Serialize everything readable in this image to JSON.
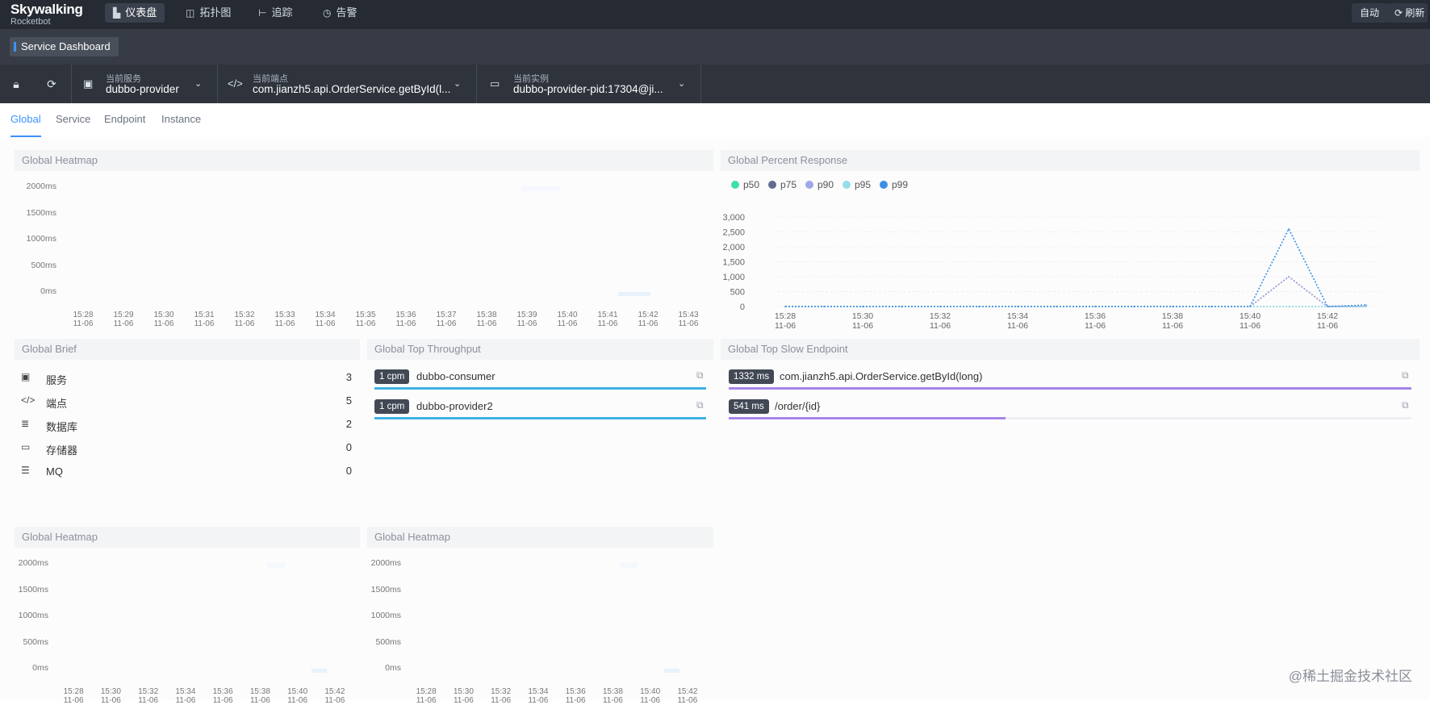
{
  "brand": {
    "name": "Skywalking",
    "sub": "Rocketbot"
  },
  "nav": [
    {
      "label": "仪表盘",
      "icon": "chart-icon"
    },
    {
      "label": "拓扑图",
      "icon": "topology-icon"
    },
    {
      "label": "追踪",
      "icon": "trace-icon"
    },
    {
      "label": "告警",
      "icon": "alarm-icon"
    }
  ],
  "top_right": {
    "auto": "自动",
    "refresh": "刷新"
  },
  "dashboard_tab": "Service Dashboard",
  "selectors": {
    "service": {
      "label": "当前服务",
      "value": "dubbo-provider"
    },
    "endpoint": {
      "label": "当前端点",
      "value": "com.jianzh5.api.OrderService.getById(l..."
    },
    "instance": {
      "label": "当前实例",
      "value": "dubbo-provider-pid:17304@ji..."
    }
  },
  "tabs": [
    "Global",
    "Service",
    "Endpoint",
    "Instance"
  ],
  "panels": {
    "heatmap_title": "Global Heatmap",
    "percent_title": "Global Percent Response",
    "brief_title": "Global Brief",
    "throughput_title": "Global Top Throughput",
    "slow_title": "Global Top Slow Endpoint"
  },
  "heatmap_y": [
    "2000ms",
    "1500ms",
    "1000ms",
    "500ms",
    "0ms"
  ],
  "heatmap_x_top": [
    "15:28",
    "15:29",
    "15:30",
    "15:31",
    "15:32",
    "15:33",
    "15:34",
    "15:35",
    "15:36",
    "15:37",
    "15:38",
    "15:39",
    "15:40",
    "15:41",
    "15:42",
    "15:43"
  ],
  "heatmap_x_bottom": [
    "15:28",
    "15:30",
    "15:32",
    "15:34",
    "15:36",
    "15:38",
    "15:40",
    "15:42"
  ],
  "date_label": "11-06",
  "brief": [
    {
      "label": "服务",
      "value": "3",
      "icon": "service-icon"
    },
    {
      "label": "端点",
      "value": "5",
      "icon": "code-icon"
    },
    {
      "label": "数据库",
      "value": "2",
      "icon": "database-icon"
    },
    {
      "label": "存储器",
      "value": "0",
      "icon": "storage-icon"
    },
    {
      "label": "MQ",
      "value": "0",
      "icon": "mq-icon"
    }
  ],
  "throughput": [
    {
      "badge": "1 cpm",
      "name": "dubbo-consumer",
      "fraction": 1.0
    },
    {
      "badge": "1 cpm",
      "name": "dubbo-provider2",
      "fraction": 1.0
    }
  ],
  "slow": [
    {
      "badge": "1332 ms",
      "name": "com.jianzh5.api.OrderService.getById(long)",
      "fraction": 1.0
    },
    {
      "badge": "541 ms",
      "name": "/order/{id}",
      "fraction": 0.406
    }
  ],
  "colors": {
    "throughput_bar": "#3fb1e3",
    "slow_bar": "#a685e9",
    "accent": "#3d92fe"
  },
  "chart_data": {
    "type": "line",
    "title": "Global Percent Response",
    "x": [
      "15:28",
      "15:29",
      "15:30",
      "15:31",
      "15:32",
      "15:33",
      "15:34",
      "15:35",
      "15:36",
      "15:37",
      "15:38",
      "15:39",
      "15:40",
      "15:41",
      "15:42",
      "15:43"
    ],
    "x_tick_labels": [
      "15:28",
      "15:30",
      "15:32",
      "15:34",
      "15:36",
      "15:38",
      "15:40",
      "15:42"
    ],
    "x_sublabel": "11-06",
    "ylim": [
      0,
      3000
    ],
    "y_ticks": [
      "3,000",
      "2,500",
      "2,000",
      "1,500",
      "1,000",
      "500",
      "0"
    ],
    "legend_position": "top-left",
    "grid": true,
    "series": [
      {
        "name": "p50",
        "color": "#3fdfa8",
        "values": [
          0,
          0,
          0,
          0,
          0,
          0,
          0,
          0,
          0,
          0,
          0,
          0,
          0,
          0,
          0,
          0
        ]
      },
      {
        "name": "p75",
        "color": "#626c91",
        "values": [
          0,
          0,
          0,
          0,
          0,
          0,
          0,
          0,
          0,
          0,
          0,
          0,
          0,
          1000,
          0,
          0
        ]
      },
      {
        "name": "p90",
        "color": "#a0a7e6",
        "values": [
          0,
          0,
          0,
          0,
          0,
          0,
          0,
          0,
          0,
          0,
          0,
          0,
          0,
          1000,
          0,
          0
        ]
      },
      {
        "name": "p95",
        "color": "#96dee8",
        "values": [
          0,
          0,
          0,
          0,
          0,
          0,
          0,
          0,
          0,
          0,
          0,
          0,
          0,
          0,
          0,
          0
        ]
      },
      {
        "name": "p99",
        "color": "#3a8fe6",
        "values": [
          0,
          0,
          0,
          0,
          0,
          0,
          0,
          0,
          0,
          0,
          0,
          0,
          0,
          2600,
          0,
          50
        ]
      }
    ]
  },
  "watermark": "@稀土掘金技术社区"
}
